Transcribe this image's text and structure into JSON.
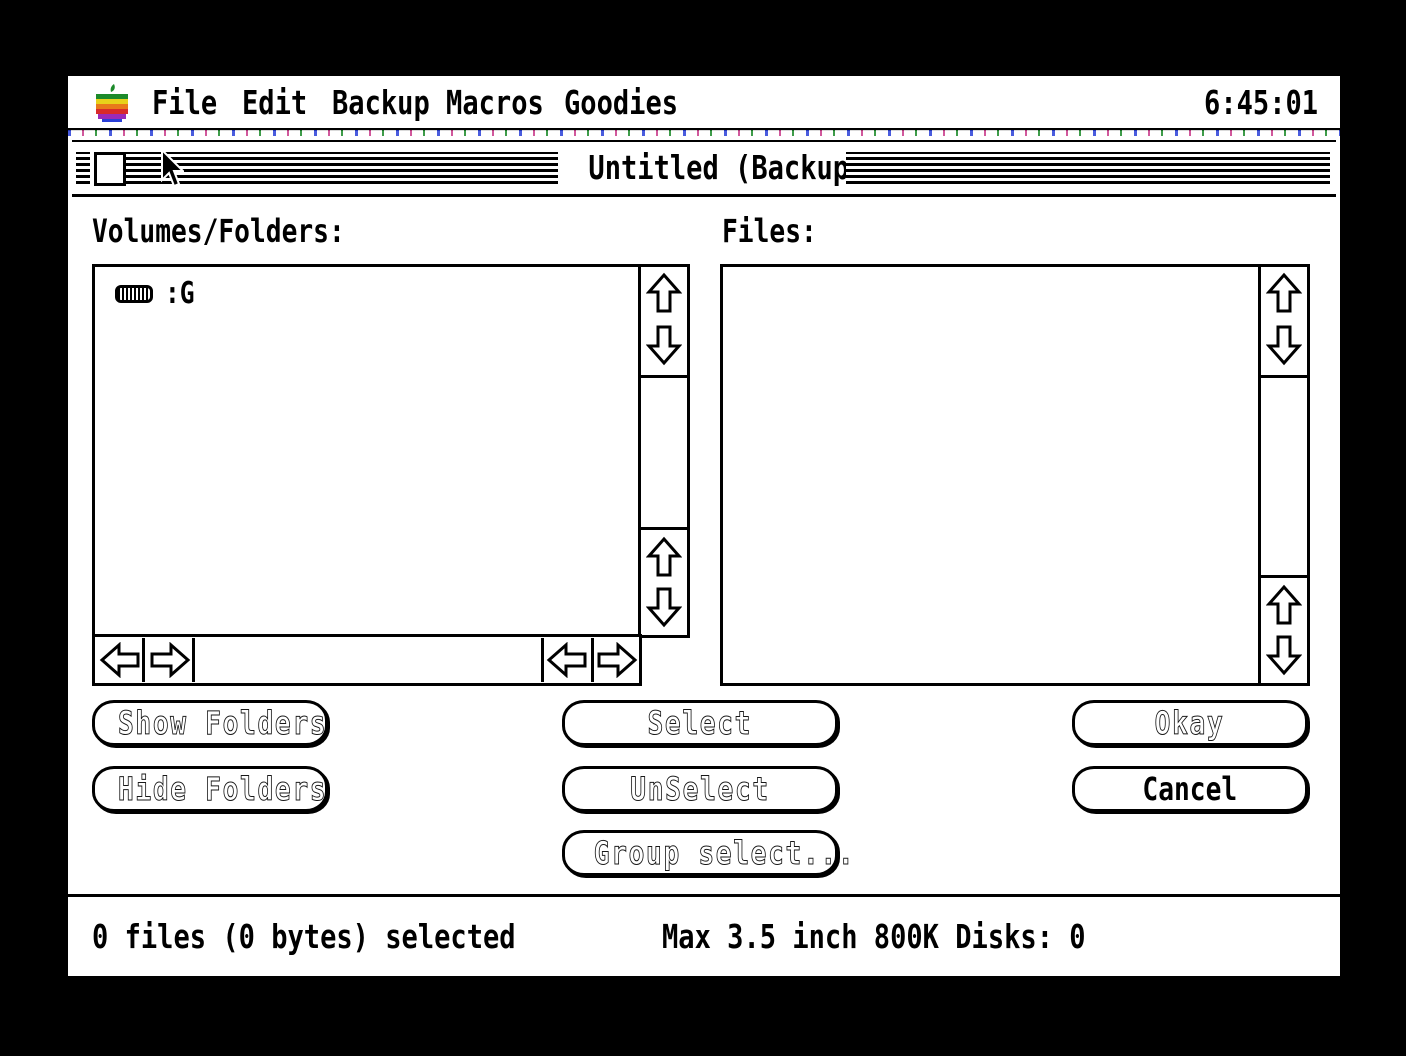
{
  "menubar": {
    "items": [
      "File",
      "Edit",
      "Backup Macros",
      "Goodies"
    ],
    "clock": "6:45:01"
  },
  "window": {
    "title": "Untitled (Backup)"
  },
  "volumes": {
    "label": "Volumes/Folders:",
    "items": [
      ":G"
    ]
  },
  "files": {
    "label": "Files:"
  },
  "buttons": {
    "show_folders": "Show Folders",
    "hide_folders": "Hide Folders",
    "select": "Select",
    "unselect": "UnSelect",
    "group_select": "Group select...",
    "okay": "Okay",
    "cancel": "Cancel"
  },
  "status": {
    "selected": "0 files (0 bytes) selected",
    "disks": "Max 3.5 inch 800K Disks: 0"
  }
}
